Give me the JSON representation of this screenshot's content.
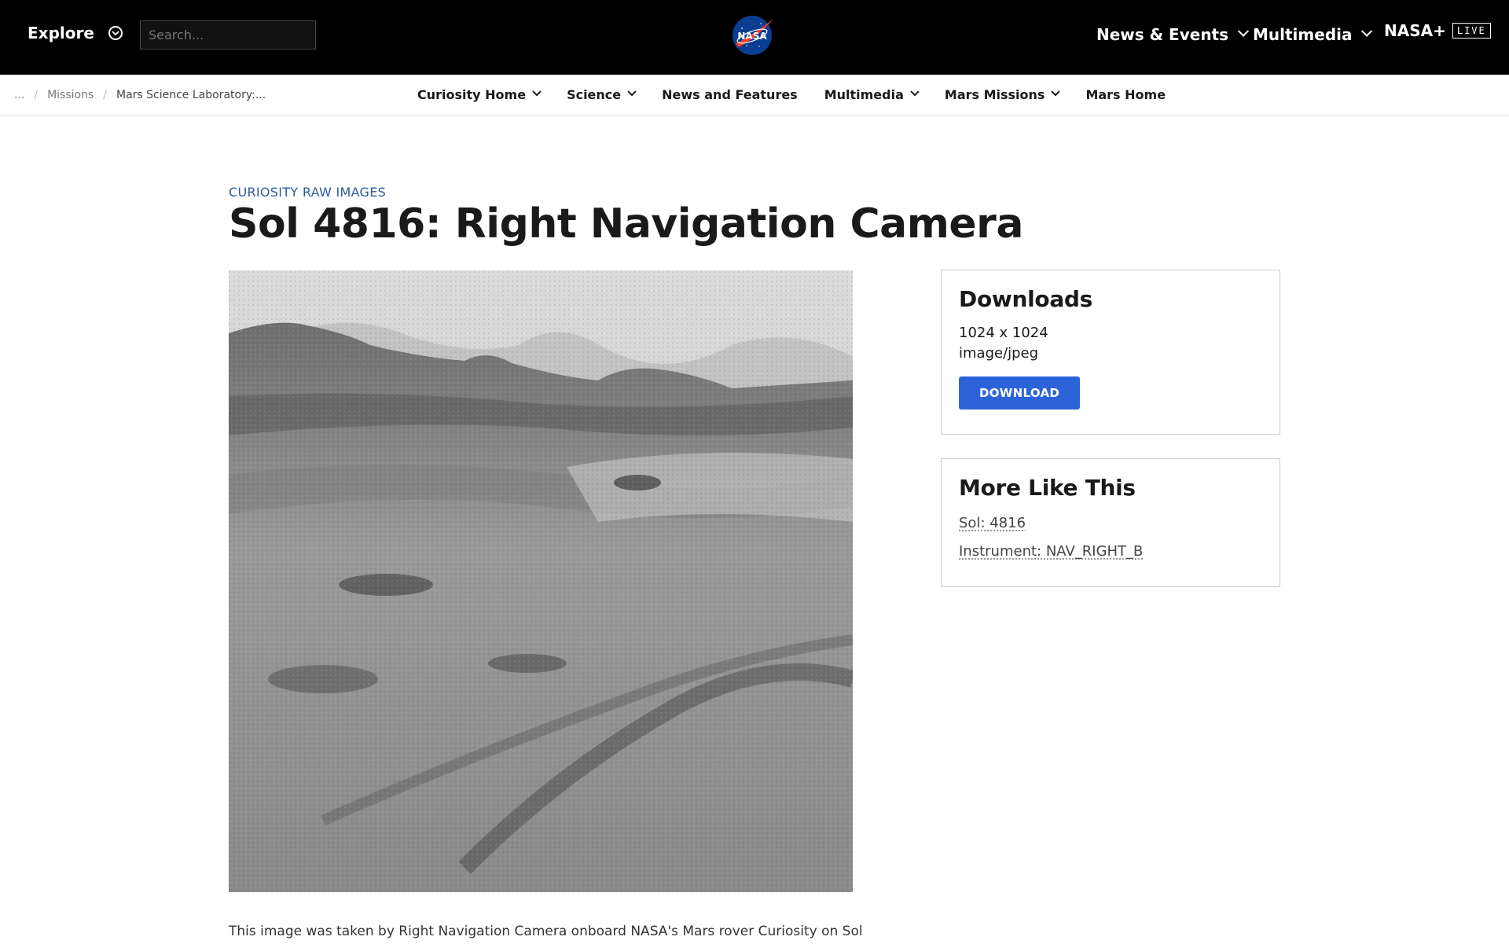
{
  "header": {
    "explore_label": "Explore",
    "search_placeholder": "Search...",
    "nav": [
      {
        "label": "News & Events"
      },
      {
        "label": "Multimedia"
      }
    ],
    "nasa_plus_label": "NASA+",
    "live_badge": "LIVE"
  },
  "breadcrumb": {
    "ellipsis": "...",
    "sep": "/",
    "items": [
      "Missions",
      "Mars Science Laboratory:..."
    ]
  },
  "subnav": [
    {
      "label": "Curiosity Home",
      "dropdown": true
    },
    {
      "label": "Science",
      "dropdown": true
    },
    {
      "label": "News and Features",
      "dropdown": false
    },
    {
      "label": "Multimedia",
      "dropdown": true
    },
    {
      "label": "Mars Missions",
      "dropdown": true
    },
    {
      "label": "Mars Home",
      "dropdown": false
    }
  ],
  "article": {
    "eyebrow": "CURIOSITY RAW IMAGES",
    "title": "Sol 4816: Right Navigation Camera",
    "caption": "This image was taken by Right Navigation Camera onboard NASA's Mars rover Curiosity on Sol"
  },
  "downloads": {
    "heading": "Downloads",
    "resolution": "1024 x 1024",
    "mime": "image/jpeg",
    "button": "DOWNLOAD"
  },
  "more_like_this": {
    "heading": "More Like This",
    "links": [
      "Sol: 4816",
      "Instrument: NAV_RIGHT_B"
    ]
  },
  "colors": {
    "accent": "#2c63d8",
    "eyebrow": "#2b5d9c",
    "topbar": "#000000"
  }
}
